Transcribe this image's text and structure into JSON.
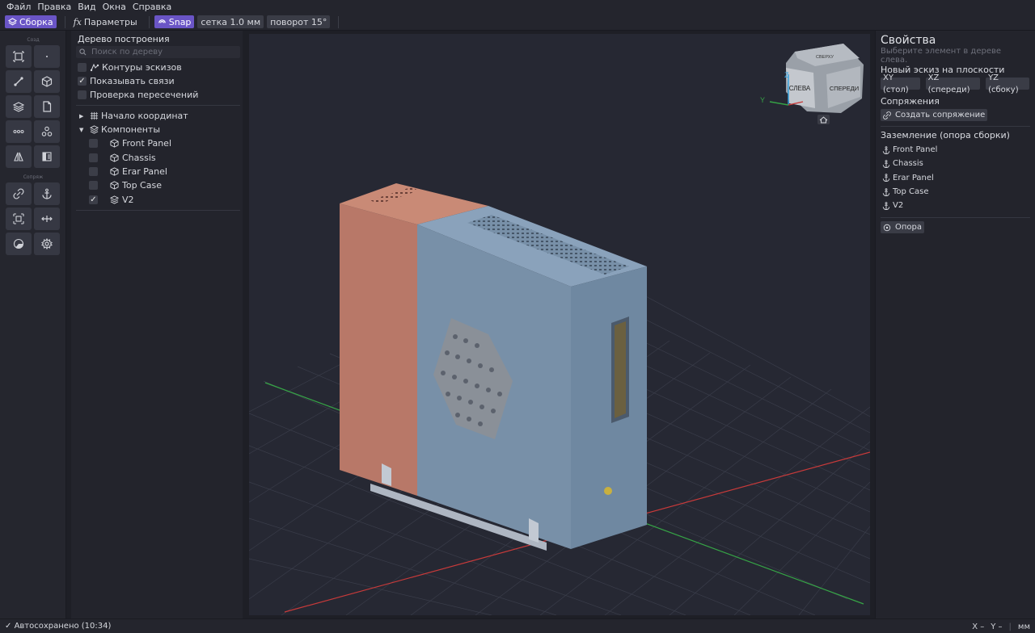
{
  "menu": [
    "Файл",
    "Правка",
    "Вид",
    "Окна",
    "Справка"
  ],
  "toolbar": {
    "assembly": "Сборка",
    "params": "Параметры",
    "snap": "Snap",
    "grid": "сетка 1.0 мм",
    "rotate": "поворот 15°"
  },
  "leftbar": {
    "group_create": "Созд",
    "group_mate": "Сопряж"
  },
  "tree": {
    "title": "Дерево построения",
    "search_placeholder": "Поиск по дереву",
    "options": [
      {
        "label": "Контуры эскизов",
        "checked": false
      },
      {
        "label": "Показывать связи",
        "checked": true
      },
      {
        "label": "Проверка пересечений",
        "checked": false
      }
    ],
    "origin": "Начало координат",
    "components_label": "Компоненты",
    "components": [
      {
        "label": "Front Panel",
        "checked": false
      },
      {
        "label": "Chassis",
        "checked": false
      },
      {
        "label": "Erar Panel",
        "checked": false
      },
      {
        "label": "Top Case",
        "checked": false
      },
      {
        "label": "V2",
        "checked": true
      }
    ]
  },
  "viewcube": {
    "left": "СЛЕВА",
    "front": "СПЕРЕДИ",
    "top": "СВЕРХУ",
    "axis_z": "Z",
    "axis_y": "Y"
  },
  "properties": {
    "title": "Свойства",
    "hint": "Выберите элемент в дереве слева.",
    "sketch_section": "Новый эскиз на плоскости",
    "planes": [
      "XY (стол)",
      "XZ (спереди)",
      "YZ (сбоку)"
    ],
    "mates_section": "Сопряжения",
    "create_mate": "Создать сопряжение",
    "ground_section": "Заземление (опора сборки)",
    "ground_items": [
      "Front Panel",
      "Chassis",
      "Erar Panel",
      "Top Case",
      "V2"
    ],
    "support_button": "Опора"
  },
  "status": {
    "left": "Автосохранено (10:34)",
    "x": "X –",
    "y": "Y –",
    "unit": "мм"
  },
  "colors": {
    "accent": "#6a55c6",
    "body_blue": "#7890a8",
    "panel_red": "#b87868",
    "axis_red": "#c83c3c",
    "axis_green": "#3cb44b"
  }
}
